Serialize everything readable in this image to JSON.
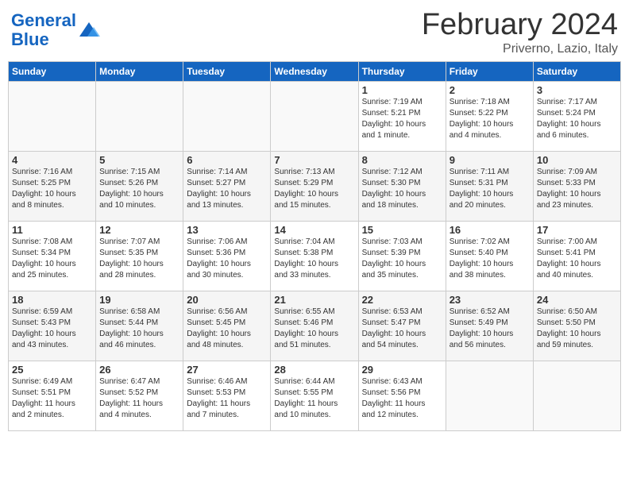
{
  "header": {
    "logo_line1": "General",
    "logo_line2": "Blue",
    "month": "February 2024",
    "location": "Priverno, Lazio, Italy"
  },
  "weekdays": [
    "Sunday",
    "Monday",
    "Tuesday",
    "Wednesday",
    "Thursday",
    "Friday",
    "Saturday"
  ],
  "weeks": [
    [
      {
        "day": "",
        "info": ""
      },
      {
        "day": "",
        "info": ""
      },
      {
        "day": "",
        "info": ""
      },
      {
        "day": "",
        "info": ""
      },
      {
        "day": "1",
        "info": "Sunrise: 7:19 AM\nSunset: 5:21 PM\nDaylight: 10 hours\nand 1 minute."
      },
      {
        "day": "2",
        "info": "Sunrise: 7:18 AM\nSunset: 5:22 PM\nDaylight: 10 hours\nand 4 minutes."
      },
      {
        "day": "3",
        "info": "Sunrise: 7:17 AM\nSunset: 5:24 PM\nDaylight: 10 hours\nand 6 minutes."
      }
    ],
    [
      {
        "day": "4",
        "info": "Sunrise: 7:16 AM\nSunset: 5:25 PM\nDaylight: 10 hours\nand 8 minutes."
      },
      {
        "day": "5",
        "info": "Sunrise: 7:15 AM\nSunset: 5:26 PM\nDaylight: 10 hours\nand 10 minutes."
      },
      {
        "day": "6",
        "info": "Sunrise: 7:14 AM\nSunset: 5:27 PM\nDaylight: 10 hours\nand 13 minutes."
      },
      {
        "day": "7",
        "info": "Sunrise: 7:13 AM\nSunset: 5:29 PM\nDaylight: 10 hours\nand 15 minutes."
      },
      {
        "day": "8",
        "info": "Sunrise: 7:12 AM\nSunset: 5:30 PM\nDaylight: 10 hours\nand 18 minutes."
      },
      {
        "day": "9",
        "info": "Sunrise: 7:11 AM\nSunset: 5:31 PM\nDaylight: 10 hours\nand 20 minutes."
      },
      {
        "day": "10",
        "info": "Sunrise: 7:09 AM\nSunset: 5:33 PM\nDaylight: 10 hours\nand 23 minutes."
      }
    ],
    [
      {
        "day": "11",
        "info": "Sunrise: 7:08 AM\nSunset: 5:34 PM\nDaylight: 10 hours\nand 25 minutes."
      },
      {
        "day": "12",
        "info": "Sunrise: 7:07 AM\nSunset: 5:35 PM\nDaylight: 10 hours\nand 28 minutes."
      },
      {
        "day": "13",
        "info": "Sunrise: 7:06 AM\nSunset: 5:36 PM\nDaylight: 10 hours\nand 30 minutes."
      },
      {
        "day": "14",
        "info": "Sunrise: 7:04 AM\nSunset: 5:38 PM\nDaylight: 10 hours\nand 33 minutes."
      },
      {
        "day": "15",
        "info": "Sunrise: 7:03 AM\nSunset: 5:39 PM\nDaylight: 10 hours\nand 35 minutes."
      },
      {
        "day": "16",
        "info": "Sunrise: 7:02 AM\nSunset: 5:40 PM\nDaylight: 10 hours\nand 38 minutes."
      },
      {
        "day": "17",
        "info": "Sunrise: 7:00 AM\nSunset: 5:41 PM\nDaylight: 10 hours\nand 40 minutes."
      }
    ],
    [
      {
        "day": "18",
        "info": "Sunrise: 6:59 AM\nSunset: 5:43 PM\nDaylight: 10 hours\nand 43 minutes."
      },
      {
        "day": "19",
        "info": "Sunrise: 6:58 AM\nSunset: 5:44 PM\nDaylight: 10 hours\nand 46 minutes."
      },
      {
        "day": "20",
        "info": "Sunrise: 6:56 AM\nSunset: 5:45 PM\nDaylight: 10 hours\nand 48 minutes."
      },
      {
        "day": "21",
        "info": "Sunrise: 6:55 AM\nSunset: 5:46 PM\nDaylight: 10 hours\nand 51 minutes."
      },
      {
        "day": "22",
        "info": "Sunrise: 6:53 AM\nSunset: 5:47 PM\nDaylight: 10 hours\nand 54 minutes."
      },
      {
        "day": "23",
        "info": "Sunrise: 6:52 AM\nSunset: 5:49 PM\nDaylight: 10 hours\nand 56 minutes."
      },
      {
        "day": "24",
        "info": "Sunrise: 6:50 AM\nSunset: 5:50 PM\nDaylight: 10 hours\nand 59 minutes."
      }
    ],
    [
      {
        "day": "25",
        "info": "Sunrise: 6:49 AM\nSunset: 5:51 PM\nDaylight: 11 hours\nand 2 minutes."
      },
      {
        "day": "26",
        "info": "Sunrise: 6:47 AM\nSunset: 5:52 PM\nDaylight: 11 hours\nand 4 minutes."
      },
      {
        "day": "27",
        "info": "Sunrise: 6:46 AM\nSunset: 5:53 PM\nDaylight: 11 hours\nand 7 minutes."
      },
      {
        "day": "28",
        "info": "Sunrise: 6:44 AM\nSunset: 5:55 PM\nDaylight: 11 hours\nand 10 minutes."
      },
      {
        "day": "29",
        "info": "Sunrise: 6:43 AM\nSunset: 5:56 PM\nDaylight: 11 hours\nand 12 minutes."
      },
      {
        "day": "",
        "info": ""
      },
      {
        "day": "",
        "info": ""
      }
    ]
  ]
}
